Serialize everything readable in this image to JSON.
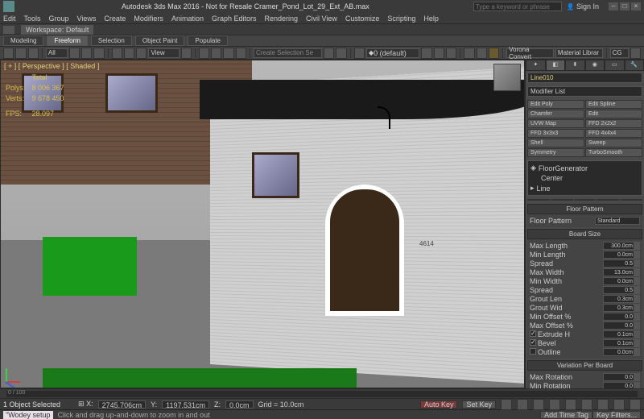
{
  "title_bar": {
    "app_title": "Autodesk 3ds Max 2016 - Not for Resale   Cramer_Pond_Lot_29_Ext_AB.max",
    "search_placeholder": "Type a keyword or phrase",
    "sign_in": "Sign In"
  },
  "menu": [
    "Edit",
    "Tools",
    "Group",
    "Views",
    "Create",
    "Modifiers",
    "Animation",
    "Graph Editors",
    "Rendering",
    "Civil View",
    "Customize",
    "Scripting",
    "Help"
  ],
  "workspace": {
    "label": "Workspace: Default"
  },
  "ribbon_tabs": [
    "Modeling",
    "Freeform",
    "Selection",
    "Object Paint",
    "Populate"
  ],
  "ribbon_active_index": 1,
  "toolbar_dropdowns": {
    "all": "All",
    "view": "View",
    "create_sel": "Create Selection Se",
    "layer": "0 (default)",
    "tool1": "Vorona Convert",
    "tool2": "Material Librar",
    "cg": "CG"
  },
  "viewport": {
    "label": "[ + ] [ Perspective ] [ Shaded ]",
    "stats_header": "Total",
    "polys_label": "Polys:",
    "polys_value": "8 006 367",
    "verts_label": "Verts:",
    "verts_value": "9 678 450",
    "fps_label": "FPS:",
    "fps_value": "28.097",
    "house_number": "4614"
  },
  "command_panel": {
    "object_name": "Line010",
    "modifier_list_label": "Modifier List",
    "modifier_buttons": [
      [
        "Edit Poly",
        "Edit Spline"
      ],
      [
        "Chamfer",
        "Edit"
      ],
      [
        "UVW Map",
        "FFD 2x2x2"
      ],
      [
        "FFD 3x3x3",
        "FFD 4x4x4"
      ],
      [
        "Shell",
        "Sweep"
      ],
      [
        "Symmetry",
        "TurboSmooth"
      ]
    ],
    "stack": {
      "top": "FloorGenerator",
      "sub": "Center",
      "base": "Line"
    },
    "rollouts": {
      "floor_pattern": {
        "title": "Floor Pattern",
        "pattern_label": "Floor Pattern",
        "pattern_value": "Standard"
      },
      "board_size": {
        "title": "Board Size",
        "rows": [
          {
            "label": "Max Length",
            "value": "300.0cm"
          },
          {
            "label": "Min Length",
            "value": "0.0cm"
          },
          {
            "label": "Spread",
            "value": "0.5"
          },
          {
            "label": "Max Width",
            "value": "13.0cm"
          },
          {
            "label": "Min Width",
            "value": "0.0cm"
          },
          {
            "label": "Spread",
            "value": "0.5"
          },
          {
            "label": "Grout Len",
            "value": "0.3cm"
          },
          {
            "label": "Grout Wid",
            "value": "0.3cm"
          },
          {
            "label": "Min Offset %",
            "value": "0.0"
          },
          {
            "label": "Max Offset %",
            "value": "0.0"
          },
          {
            "label": "Extrude H",
            "value": "0.1cm",
            "checked": true
          },
          {
            "label": "Bevel",
            "value": "0.1cm",
            "checked": true
          },
          {
            "label": "Outline",
            "value": "0.0cm",
            "checked": false
          }
        ]
      },
      "variation": {
        "title": "Variation Per Board",
        "rows": [
          {
            "label": "Max Rotation",
            "value": "0.0"
          },
          {
            "label": "Min Rotation",
            "value": "0.0"
          }
        ]
      }
    }
  },
  "timeline": {
    "range": "0 / 100"
  },
  "status": {
    "selection": "1 Object Selected",
    "x": "2745.706cm",
    "y": "1197.531cm",
    "z": "0.0cm",
    "grid": "Grid = 10.0cm",
    "autokey": "Auto Key",
    "setkey": "Set Key",
    "add_time_tag": "Add Time Tag",
    "key_filters": "Key Filters..."
  },
  "prompt": {
    "command": "\"Wodey setup",
    "hint": "Click and drag up-and-down to zoom in and out"
  }
}
